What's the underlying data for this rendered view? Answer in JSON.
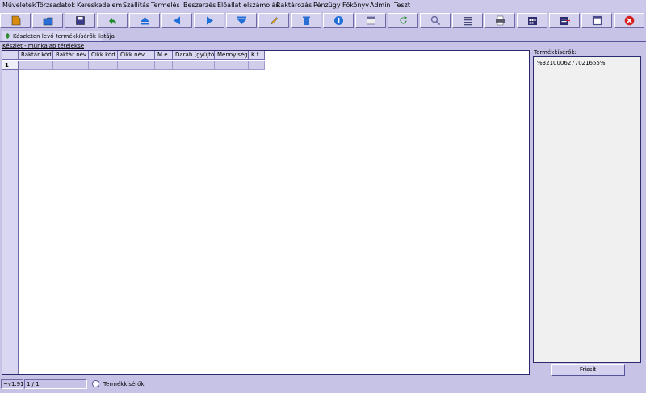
{
  "menu": [
    "Műveletek",
    "Törzsadatok",
    "Kereskedelem",
    "Szállítás",
    "Termelés",
    "Beszerzés",
    "Előállat elszámolás",
    "Raktározás",
    "Pénzügy",
    "Főkönyv",
    "Admin",
    "Teszt"
  ],
  "toolbar": {
    "buttons": [
      {
        "icon": "new-icon",
        "color": "#d98a10"
      },
      {
        "icon": "open-icon",
        "color": "#2a6fd6"
      },
      {
        "icon": "save-icon",
        "color": "#3b3b8c"
      },
      {
        "icon": "undo-icon",
        "color": "#1f8a2a"
      },
      {
        "icon": "first-icon",
        "color": "#1f6fd6"
      },
      {
        "icon": "previous-icon",
        "color": "#1f6fd6"
      },
      {
        "icon": "next-icon",
        "color": "#1f6fd6"
      },
      {
        "icon": "last-icon",
        "color": "#1f6fd6"
      },
      {
        "icon": "edit-icon",
        "color": "#d9a020"
      },
      {
        "icon": "delete-icon",
        "color": "#2a6fd6"
      },
      {
        "icon": "info-icon",
        "color": "#1f6fd6"
      },
      {
        "icon": "window-icon",
        "color": "#6a6a9a"
      },
      {
        "icon": "refresh-icon",
        "color": "#1f8a2a"
      },
      {
        "icon": "search-icon",
        "color": "#6a6aa0"
      },
      {
        "icon": "list-icon",
        "color": "#4a4a7a"
      },
      {
        "icon": "print-icon",
        "color": "#5a5a6a"
      },
      {
        "icon": "calendar-icon",
        "color": "#2c2c6e"
      },
      {
        "icon": "export-icon",
        "color": "#2c2c6e"
      },
      {
        "icon": "maximize-icon",
        "color": "#4a4a8a"
      },
      {
        "icon": "close-icon",
        "color": "#d62020"
      }
    ]
  },
  "tab": {
    "label": "Készleten levő termékkísérők listája",
    "icon": "leaf-icon"
  },
  "section_label": "Készlet - munkalap tételekse",
  "grid": {
    "columns": [
      "Raktár kód",
      "Raktár név",
      "Cikk kód",
      "Cikk név",
      "M.e.",
      "Darab (gyűjtő)",
      "Mennyiség",
      "K.t."
    ],
    "rows": [
      {
        "num": "1",
        "cells": [
          "",
          "",
          "",
          "",
          "",
          "",
          "",
          ""
        ]
      }
    ]
  },
  "side_panel": {
    "label": "Termékkísérők:",
    "text": "%3210006277021655%",
    "button": "Frissít"
  },
  "status": {
    "version": "~v1.91E",
    "page": "1 / 1",
    "radio_label": "Termékkísérők"
  }
}
